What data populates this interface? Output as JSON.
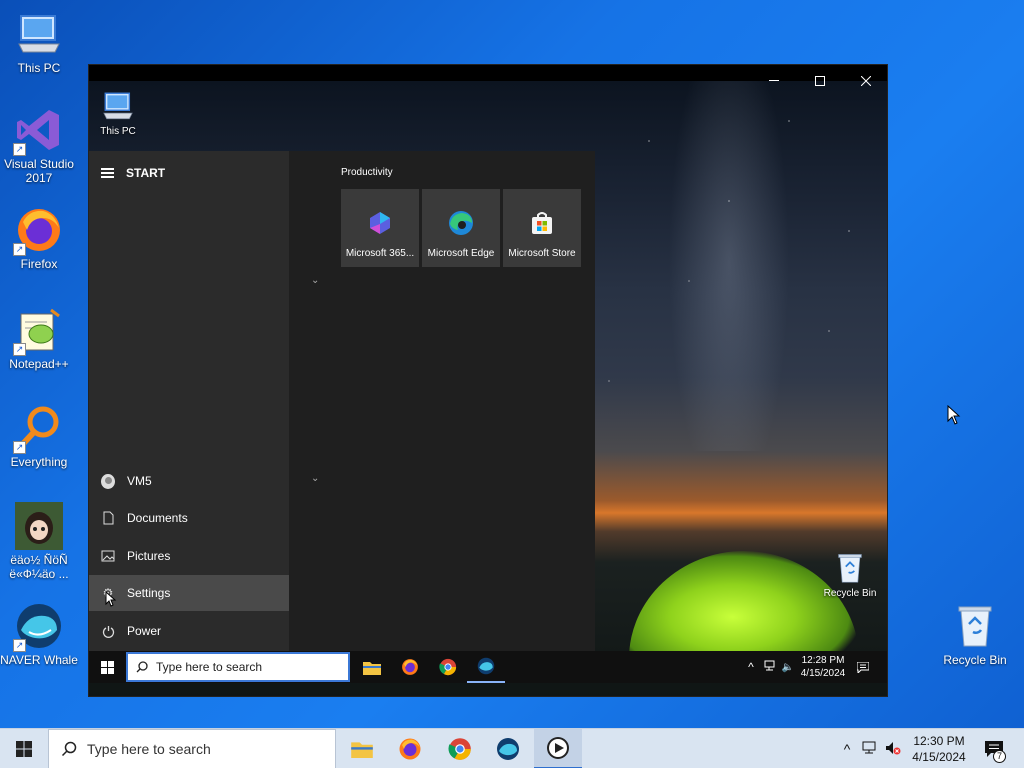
{
  "desktop": {
    "icons": [
      {
        "label": "This PC"
      },
      {
        "label": "Visual Studio 2017"
      },
      {
        "label": "Firefox"
      },
      {
        "label": "Notepad++"
      },
      {
        "label": "Everything"
      },
      {
        "label": "ëäo½ ÑöÑ ë«Ф¼äo ..."
      },
      {
        "label": "NAVER Whale"
      },
      {
        "label": "Recycle Bin"
      }
    ]
  },
  "vm": {
    "desktop_icons": [
      {
        "label": "This PC"
      },
      {
        "label": "Recycle Bin"
      }
    ],
    "start_menu": {
      "header": "START",
      "user": "VM5",
      "items": [
        {
          "label": "Documents"
        },
        {
          "label": "Pictures"
        },
        {
          "label": "Settings"
        },
        {
          "label": "Power"
        }
      ],
      "section_title": "Productivity",
      "tiles": [
        {
          "label": "Microsoft 365..."
        },
        {
          "label": "Microsoft Edge"
        },
        {
          "label": "Microsoft Store"
        }
      ]
    },
    "taskbar": {
      "search_placeholder": "Type here to search",
      "time": "12:28 PM",
      "date": "4/15/2024"
    }
  },
  "taskbar": {
    "search_placeholder": "Type here to search",
    "time": "12:30 PM",
    "date": "4/15/2024",
    "notification_count": "7"
  },
  "colors": {
    "accent": "#2e6fcf",
    "start_menu_bg": "#2b2b2b",
    "tile_bg": "#3a3a3a"
  }
}
